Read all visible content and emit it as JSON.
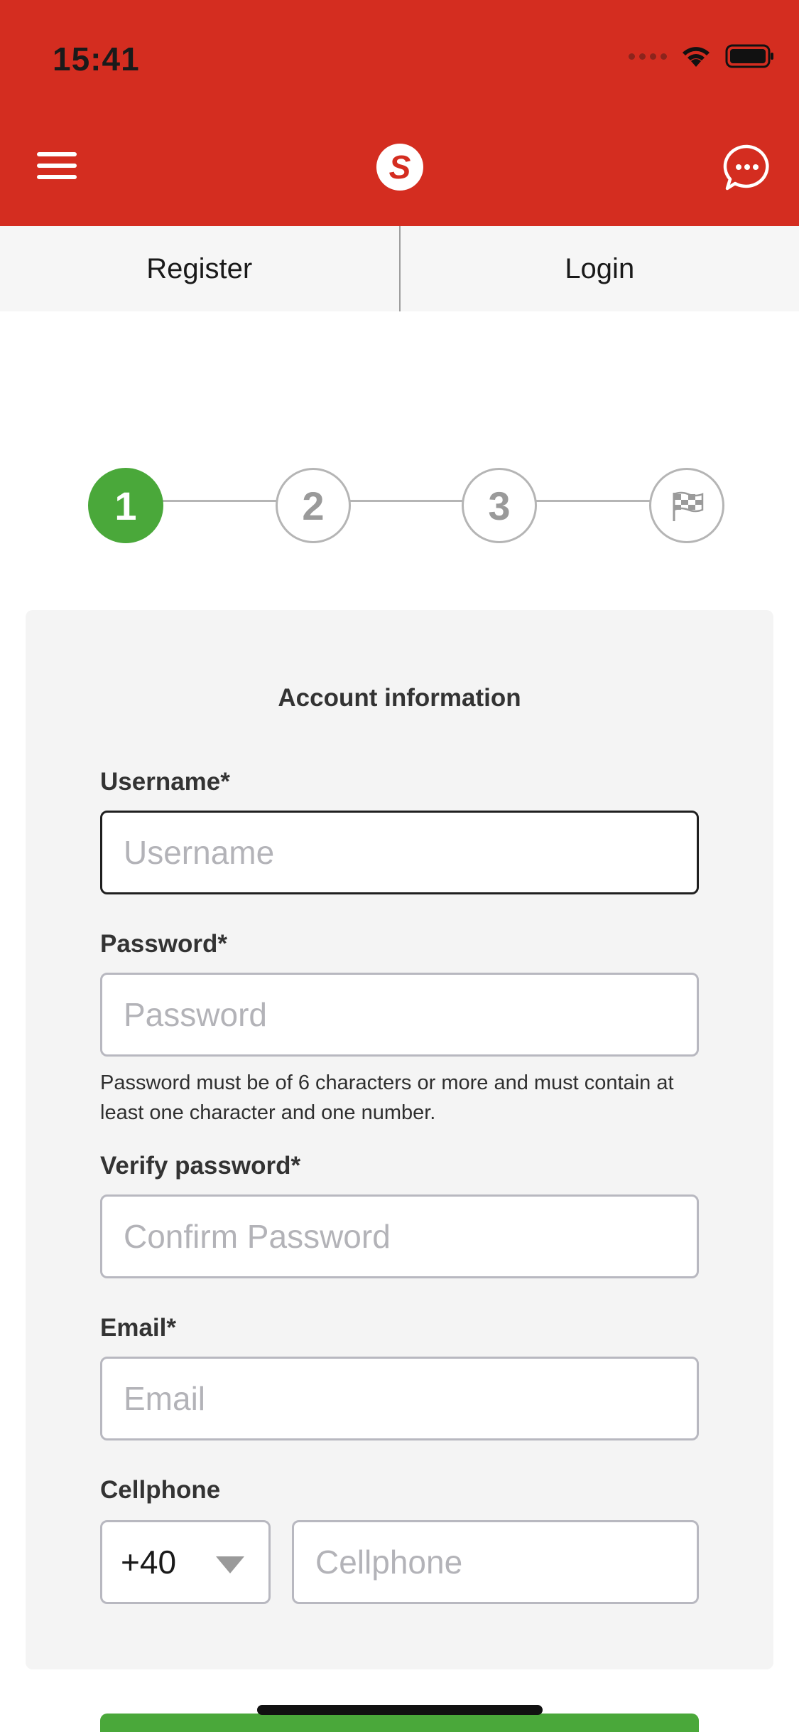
{
  "status_bar": {
    "time": "15:41"
  },
  "header": {
    "menu_icon": "hamburger-icon",
    "logo_text": "S",
    "chat_icon": "chat-bubble-icon",
    "brand_color": "#d42d20"
  },
  "tabs": [
    {
      "label": "Register"
    },
    {
      "label": "Login"
    }
  ],
  "stepper": {
    "steps": [
      "1",
      "2",
      "3"
    ],
    "final_icon": "checkered-flag-icon",
    "active_step": 1,
    "active_color": "#4aa83a"
  },
  "form": {
    "title": "Account information",
    "username": {
      "label": "Username*",
      "placeholder": "Username"
    },
    "password": {
      "label": "Password*",
      "placeholder": "Password",
      "hint": "Password must be of 6 characters or more and must contain at least one character and one number."
    },
    "verify_password": {
      "label": "Verify password*",
      "placeholder": "Confirm Password"
    },
    "email": {
      "label": "Email*",
      "placeholder": "Email"
    },
    "cellphone": {
      "label": "Cellphone",
      "country_code": "+40",
      "placeholder": "Cellphone"
    }
  }
}
